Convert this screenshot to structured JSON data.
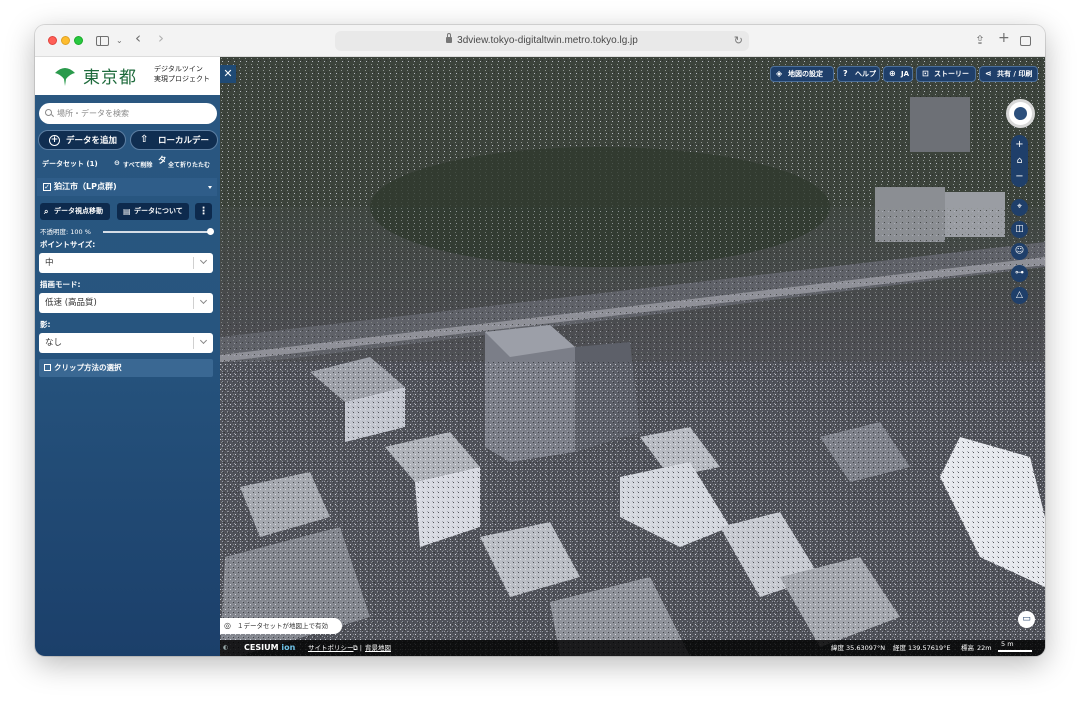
{
  "browser": {
    "url": "3dview.tokyo-digitaltwin.metro.tokyo.lg.jp"
  },
  "logo": {
    "name": "東京都",
    "sub1": "デジタルツイン",
    "sub2": "実現プロジェクト"
  },
  "search": {
    "placeholder": "場所・データを検索"
  },
  "actions": {
    "add_data": "データを追加",
    "local_data": "ローカルデータ"
  },
  "dataset": {
    "count_label": "データセット (1)",
    "remove_all": "すべて削除",
    "collapse_all": "全て折りたたむ"
  },
  "layer": {
    "title": "狛江市（LP点群)",
    "zoom_btn": "データ視点移動",
    "about_btn": "データについて",
    "opacity_label": "不透明度: 100 %",
    "opacity_value": 100,
    "point_size_label": "ポイントサイズ:",
    "point_size_value": "中",
    "render_mode_label": "描画モード:",
    "render_mode_value": "低速 (高品質)",
    "shadow_label": "影:",
    "shadow_value": "なし",
    "clip_label": "クリップ方法の選択"
  },
  "map_toolbar": {
    "settings": "地図の設定",
    "help": "ヘルプ",
    "lang": "JA",
    "story": "ストーリー",
    "share": "共有 / 印刷"
  },
  "map_status": {
    "datasets_on_map": "１データセットが地図上で有効",
    "latitude_label": "緯度",
    "latitude": "35.63097°N",
    "longitude_label": "経度",
    "longitude": "139.57619°E",
    "elevation_label": "標高",
    "elevation": "22m",
    "scale": "5 m",
    "site_policy": "サイトポリシー",
    "basemap": "背景地図",
    "cesium": "CESIUM",
    "ion": "ion"
  },
  "colors": {
    "panel_bg": "#27557f",
    "button_dark": "#102e51",
    "tokyo_green": "#1d6a3b"
  }
}
